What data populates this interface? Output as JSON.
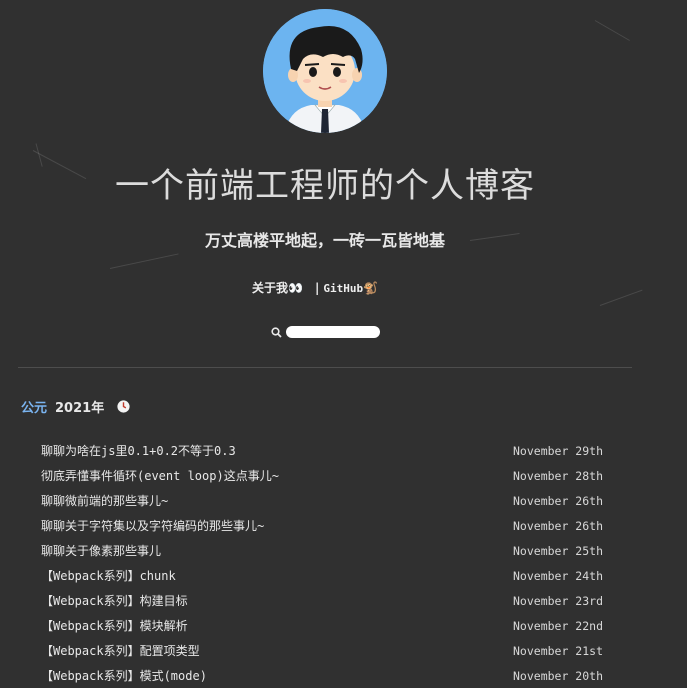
{
  "header": {
    "title": "一个前端工程师的个人博客",
    "subtitle": "万丈高楼平地起，一砖一瓦皆地基"
  },
  "nav": {
    "about_label": "关于我",
    "about_emoji": "👀",
    "separator": "|",
    "github_label": "GitHub",
    "github_emoji": "🐒"
  },
  "search": {
    "icon": "search-icon",
    "value": "",
    "placeholder": ""
  },
  "archive": {
    "era_label": "公元",
    "year_label": "2021年",
    "year_icon": "clock-icon",
    "posts": [
      {
        "title": "聊聊为啥在js里0.1+0.2不等于0.3",
        "date": "November 29th"
      },
      {
        "title": "彻底弄懂事件循环(event loop)这点事儿~",
        "date": "November 28th"
      },
      {
        "title": "聊聊微前端的那些事儿~",
        "date": "November 26th"
      },
      {
        "title": "聊聊关于字符集以及字符编码的那些事儿~",
        "date": "November 26th"
      },
      {
        "title": "聊聊关于像素那些事儿",
        "date": "November 25th"
      },
      {
        "title": "【Webpack系列】chunk",
        "date": "November 24th"
      },
      {
        "title": "【Webpack系列】构建目标",
        "date": "November 23rd"
      },
      {
        "title": "【Webpack系列】模块解析",
        "date": "November 22nd"
      },
      {
        "title": "【Webpack系列】配置项类型",
        "date": "November 21st"
      },
      {
        "title": "【Webpack系列】模式(mode)",
        "date": "November 20th"
      }
    ]
  },
  "colors": {
    "background": "#303030",
    "accent": "#7ab4f0",
    "avatar_bg": "#6cb4f0"
  }
}
